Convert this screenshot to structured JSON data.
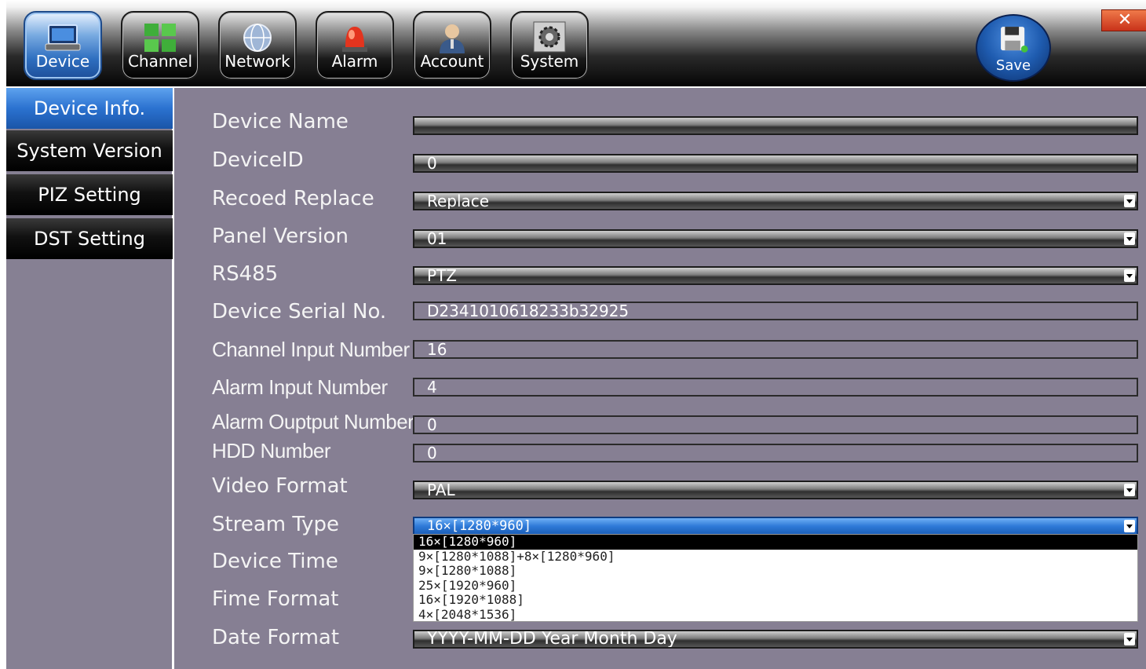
{
  "toolbar": {
    "tabs": [
      {
        "label": "Device",
        "icon": "device-icon"
      },
      {
        "label": "Channel",
        "icon": "channel-grid-icon"
      },
      {
        "label": "Network",
        "icon": "network-globe-icon"
      },
      {
        "label": "Alarm",
        "icon": "alarm-light-icon"
      },
      {
        "label": "Account",
        "icon": "account-user-icon"
      },
      {
        "label": "System",
        "icon": "system-gear-icon"
      }
    ],
    "active_tab": "Device",
    "save_label": "Save",
    "close_symbol": "✕"
  },
  "sidebar": {
    "items": [
      {
        "label": "Device Info."
      },
      {
        "label": "System Version"
      },
      {
        "label": "PIZ Setting"
      },
      {
        "label": "DST Setting"
      }
    ],
    "active_item": "Device Info."
  },
  "form": {
    "device_name": {
      "label": "Device Name",
      "value": ""
    },
    "device_id": {
      "label": "DeviceID",
      "value": "0"
    },
    "record_replace": {
      "label": "Recoed Replace",
      "value": "Replace"
    },
    "panel_version": {
      "label": "Panel Version",
      "value": "01"
    },
    "rs485": {
      "label": "RS485",
      "value": "PTZ"
    },
    "serial_no": {
      "label": "Device Serial No.",
      "value": "D2341010618233b32925"
    },
    "channel_input": {
      "label": "Channel Input Number",
      "value": "16"
    },
    "alarm_input": {
      "label": "Alarm Input Number",
      "value": "4"
    },
    "alarm_output": {
      "label": "Alarm Ouptput Number",
      "value": "0"
    },
    "hdd_number": {
      "label": "HDD Number",
      "value": "0"
    },
    "video_format": {
      "label": "Video Format",
      "value": "PAL"
    },
    "stream_type": {
      "label": "Stream Type",
      "value": "16×[1280*960]",
      "options": [
        "16×[1280*960]",
        "9×[1280*1088]+8×[1280*960]",
        "9×[1280*1088]",
        "25×[1920*960]",
        "16×[1920*1088]",
        "4×[2048*1536]"
      ]
    },
    "device_time": {
      "label": "Device Time"
    },
    "time_format": {
      "label": "Fime Format"
    },
    "date_format": {
      "label": "Date Format",
      "value": "YYYY-MM-DD Year Month Day"
    }
  },
  "colors": {
    "panel_bg": "#867f93",
    "active_blue": "#2b72d0",
    "close_red": "#d8431f"
  }
}
